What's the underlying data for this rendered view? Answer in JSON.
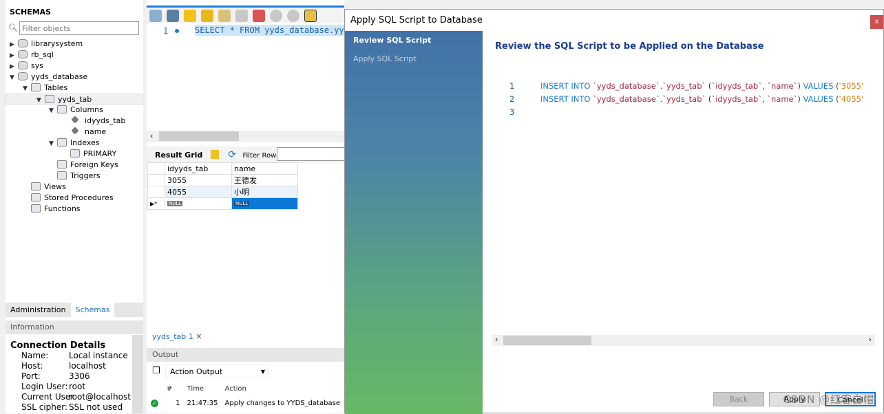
{
  "schemas": {
    "title": "SCHEMAS",
    "filter_placeholder": "Filter objects",
    "tree": [
      {
        "label": "librarysystem",
        "level": 0,
        "toggle": "▶",
        "icon": "database"
      },
      {
        "label": "rb_sql",
        "level": 0,
        "toggle": "▶",
        "icon": "database"
      },
      {
        "label": "sys",
        "level": 0,
        "toggle": "▶",
        "icon": "database"
      },
      {
        "label": "yyds_database",
        "level": 0,
        "toggle": "▼",
        "icon": "database"
      },
      {
        "label": "Tables",
        "level": 1,
        "toggle": "▼",
        "icon": "folder"
      },
      {
        "label": "yyds_tab",
        "level": 2,
        "toggle": "▼",
        "icon": "table",
        "selected": true
      },
      {
        "label": "Columns",
        "level": 3,
        "toggle": "▼",
        "icon": "folder"
      },
      {
        "label": "idyyds_tab",
        "level": 4,
        "toggle": "",
        "icon": "column"
      },
      {
        "label": "name",
        "level": 4,
        "toggle": "",
        "icon": "column"
      },
      {
        "label": "Indexes",
        "level": 3,
        "toggle": "▼",
        "icon": "folder"
      },
      {
        "label": "PRIMARY",
        "level": 4,
        "toggle": "",
        "icon": "index"
      },
      {
        "label": "Foreign Keys",
        "level": 3,
        "toggle": "",
        "icon": "folder"
      },
      {
        "label": "Triggers",
        "level": 3,
        "toggle": "",
        "icon": "folder"
      },
      {
        "label": "Views",
        "level": 1,
        "toggle": "",
        "icon": "folder"
      },
      {
        "label": "Stored Procedures",
        "level": 1,
        "toggle": "",
        "icon": "folder"
      },
      {
        "label": "Functions",
        "level": 1,
        "toggle": "",
        "icon": "folder"
      }
    ]
  },
  "left_tabs": [
    {
      "label": "Administration"
    },
    {
      "label": "Schemas",
      "active": true
    }
  ],
  "info": {
    "title": "Information",
    "heading": "Connection Details",
    "rows": [
      {
        "k": "Name:",
        "v": "Local instance"
      },
      {
        "k": "Host:",
        "v": "localhost"
      },
      {
        "k": "Port:",
        "v": "3306"
      },
      {
        "k": "Login User:",
        "v": "root"
      },
      {
        "k": "Current User",
        "v": "root@localhost"
      },
      {
        "k": "SSL cipher:",
        "v": "SSL not used"
      }
    ]
  },
  "editor": {
    "line": "1",
    "sql": "SELECT * FROM yyds_database.yyds_tab"
  },
  "result": {
    "grid_label": "Result Grid",
    "filter_label": "Filter Rows:",
    "columns": [
      "idyyds_tab",
      "name"
    ],
    "rows": [
      [
        "3055",
        "王德发"
      ],
      [
        "4055",
        "小明"
      ]
    ],
    "null_label": "NULL"
  },
  "query_tab": "yyds_tab 1",
  "output": {
    "title": "Output",
    "selector": "Action Output",
    "columns": [
      "#",
      "Time",
      "Action"
    ],
    "rows": [
      {
        "n": "1",
        "time": "21:47:35",
        "action": "Apply changes to YYDS_database",
        "status": "success"
      }
    ]
  },
  "dialog": {
    "title": "Apply SQL Script to Database",
    "close": "x",
    "steps": [
      {
        "label": "Review SQL Script",
        "active": true
      },
      {
        "label": "Apply SQL Script"
      }
    ],
    "heading": "Review the SQL Script to be Applied on the Database",
    "script": [
      {
        "n": "1",
        "kw1": "INSERT INTO ",
        "db": "`yyds_database`",
        "dot": ".",
        "tb": "`yyds_tab`",
        "cols1": " (",
        "c1": "`idyyds_tab`",
        "comma": ", ",
        "c2": "`name`",
        "cols2": ") ",
        "kw2": "VALUES ",
        "p": "(",
        "val": "'3055'"
      },
      {
        "n": "2",
        "kw1": "INSERT INTO ",
        "db": "`yyds_database`",
        "dot": ".",
        "tb": "`yyds_tab`",
        "cols1": " (",
        "c1": "`idyyds_tab`",
        "comma": ", ",
        "c2": "`name`",
        "cols2": ") ",
        "kw2": "VALUES ",
        "p": "(",
        "val": "'4055'"
      },
      {
        "n": "3"
      }
    ],
    "buttons": {
      "back": "Back",
      "apply": "Apply",
      "cancel": "Cancel"
    }
  },
  "watermark": "CSDN @红客白帽"
}
